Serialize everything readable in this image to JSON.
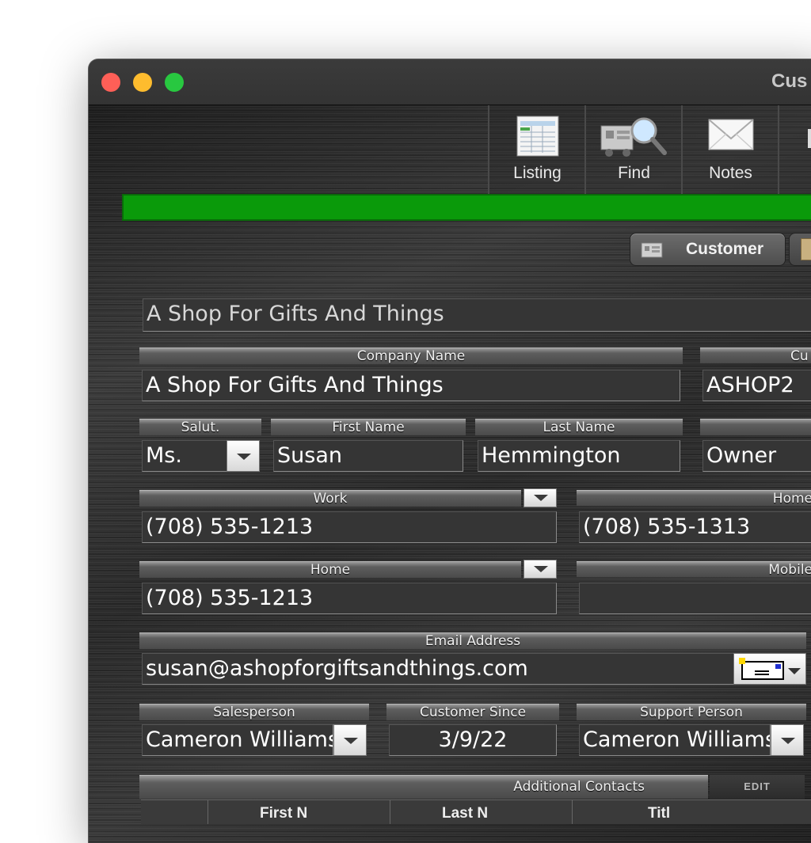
{
  "window": {
    "title": "Cus"
  },
  "toolbar": {
    "buttons": [
      {
        "label": "Listing",
        "icon": "listing-icon"
      },
      {
        "label": "Find",
        "icon": "find-icon"
      },
      {
        "label": "Notes",
        "icon": "notes-icon"
      }
    ]
  },
  "progress": {
    "color": "#0a9a0a",
    "fill_percent": 100
  },
  "segment": {
    "customer_label": "Customer"
  },
  "record": {
    "display_name": "A Shop For Gifts And Things",
    "company_name_label": "Company Name",
    "company_name": "A Shop For Gifts And Things",
    "customer_id_label": "Cu",
    "customer_id": "ASHOP2",
    "salutation_label": "Salut.",
    "salutation": "Ms.",
    "first_name_label": "First Name",
    "first_name": "Susan",
    "last_name_label": "Last Name",
    "last_name": "Hemmington",
    "title_value": "Owner",
    "phone1_label": "Work",
    "phone1": "(708) 535-1213",
    "phone2_label": "Home",
    "phone2": "(708) 535-1313",
    "phone3_label": "Home",
    "phone3": "(708) 535-1213",
    "phone4_label": "Mobile",
    "phone4": "",
    "email_label": "Email Address",
    "email": "susan@ashopforgiftsandthings.com",
    "salesperson_label": "Salesperson",
    "salesperson": "Cameron Williams",
    "customer_since_label": "Customer Since",
    "customer_since": "3/9/22",
    "support_label": "Support Person",
    "support": "Cameron Williams"
  },
  "contacts": {
    "label": "Additional Contacts",
    "edit_label": "EDIT",
    "columns": [
      "First N",
      "Last N",
      "Titl"
    ]
  }
}
